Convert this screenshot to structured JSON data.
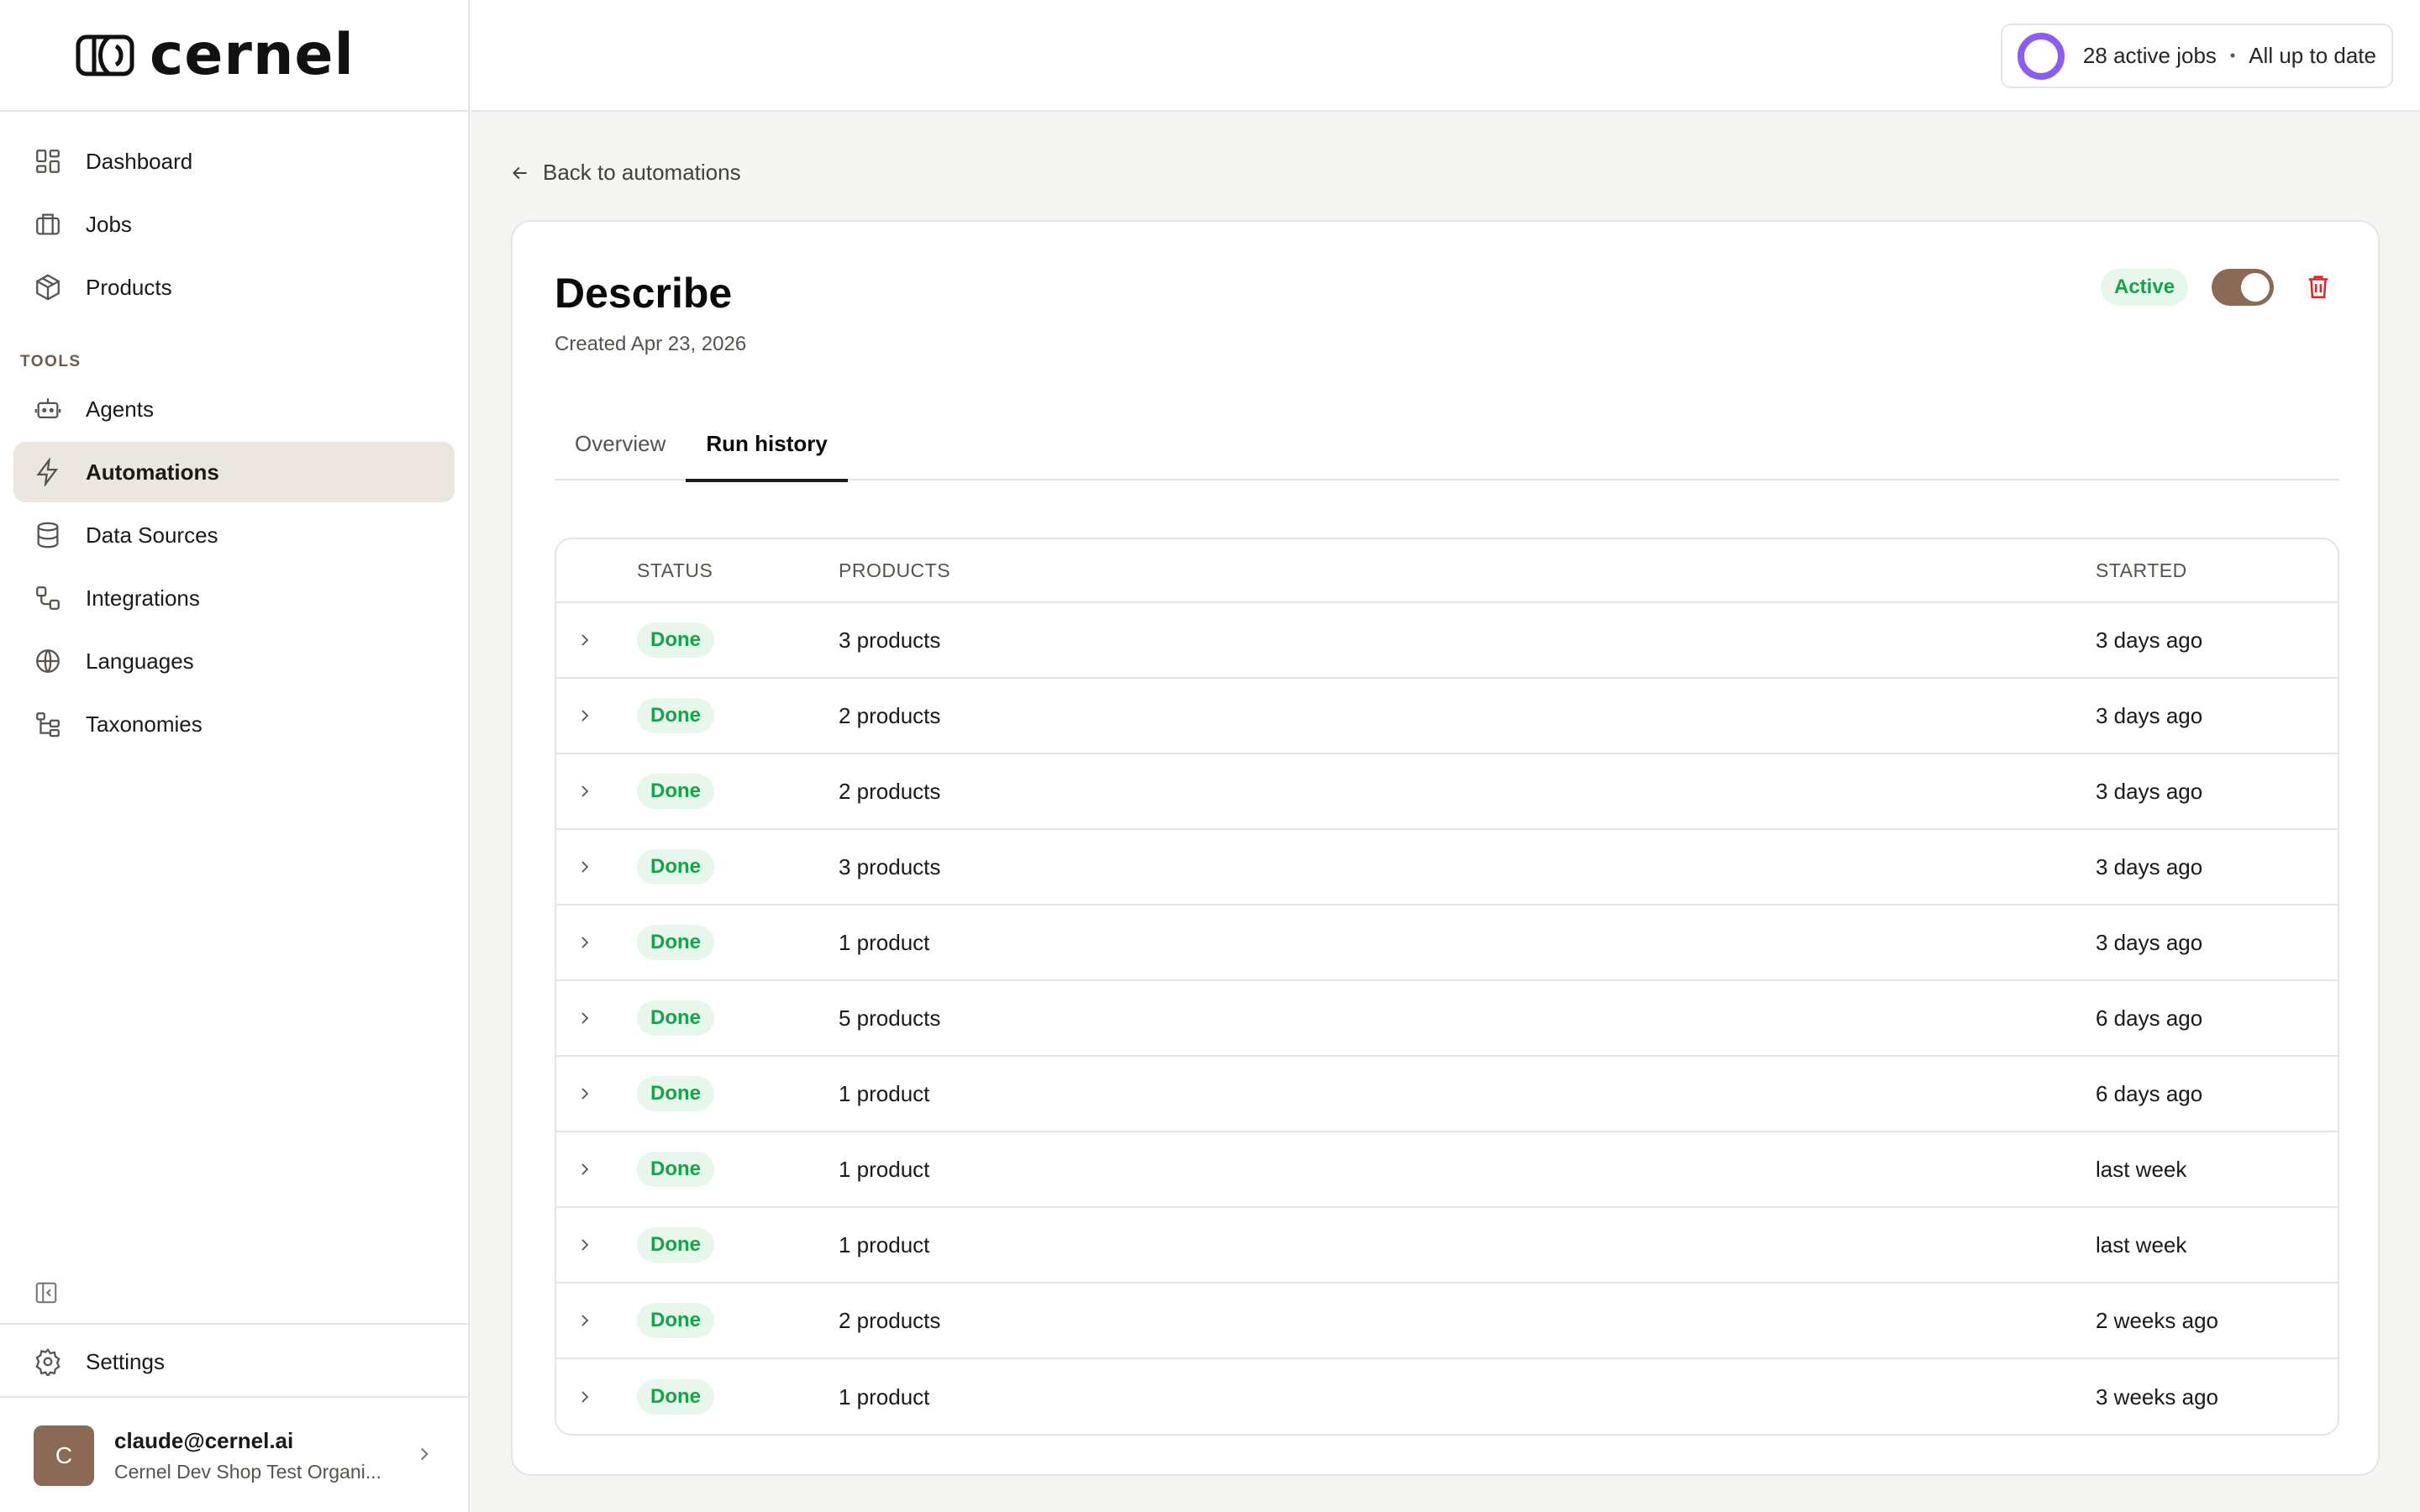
{
  "brand": {
    "name": "cernel"
  },
  "sidebar": {
    "main_items": [
      {
        "label": "Dashboard",
        "icon": "dashboard-icon"
      },
      {
        "label": "Jobs",
        "icon": "jobs-icon"
      },
      {
        "label": "Products",
        "icon": "box-icon"
      }
    ],
    "tools_label": "TOOLS",
    "tool_items": [
      {
        "label": "Agents",
        "icon": "robot-icon"
      },
      {
        "label": "Automations",
        "icon": "lightning-icon",
        "active": true
      },
      {
        "label": "Data Sources",
        "icon": "database-icon"
      },
      {
        "label": "Integrations",
        "icon": "integrations-icon"
      },
      {
        "label": "Languages",
        "icon": "globe-icon"
      },
      {
        "label": "Taxonomies",
        "icon": "taxonomy-icon"
      }
    ],
    "settings_label": "Settings",
    "user": {
      "avatar_initial": "C",
      "email": "claude@cernel.ai",
      "org": "Cernel Dev Shop Test Organi..."
    }
  },
  "topbar": {
    "active_jobs": "28 active jobs",
    "separator": "•",
    "sync_status": "All up to date"
  },
  "page": {
    "back_label": "Back to automations",
    "title": "Describe",
    "created": "Created Apr 23, 2026",
    "status": "Active",
    "enabled": true,
    "tabs": [
      {
        "label": "Overview",
        "active": false
      },
      {
        "label": "Run history",
        "active": true
      }
    ]
  },
  "run_table": {
    "headers": {
      "status": "STATUS",
      "products": "PRODUCTS",
      "started": "STARTED"
    },
    "rows": [
      {
        "status": "Done",
        "products": "3 products",
        "started": "3 days ago"
      },
      {
        "status": "Done",
        "products": "2 products",
        "started": "3 days ago"
      },
      {
        "status": "Done",
        "products": "2 products",
        "started": "3 days ago"
      },
      {
        "status": "Done",
        "products": "3 products",
        "started": "3 days ago"
      },
      {
        "status": "Done",
        "products": "1 product",
        "started": "3 days ago"
      },
      {
        "status": "Done",
        "products": "5 products",
        "started": "6 days ago"
      },
      {
        "status": "Done",
        "products": "1 product",
        "started": "6 days ago"
      },
      {
        "status": "Done",
        "products": "1 product",
        "started": "last week"
      },
      {
        "status": "Done",
        "products": "1 product",
        "started": "last week"
      },
      {
        "status": "Done",
        "products": "2 products",
        "started": "2 weeks ago"
      },
      {
        "status": "Done",
        "products": "1 product",
        "started": "3 weeks ago"
      }
    ]
  },
  "colors": {
    "accent": "#8a6a55",
    "active_nav_bg": "#ebe6df",
    "success_text": "#16a34a",
    "success_bg": "#e8f7ec",
    "progress_ring": "#8b5cf6",
    "danger": "#dc2626"
  }
}
